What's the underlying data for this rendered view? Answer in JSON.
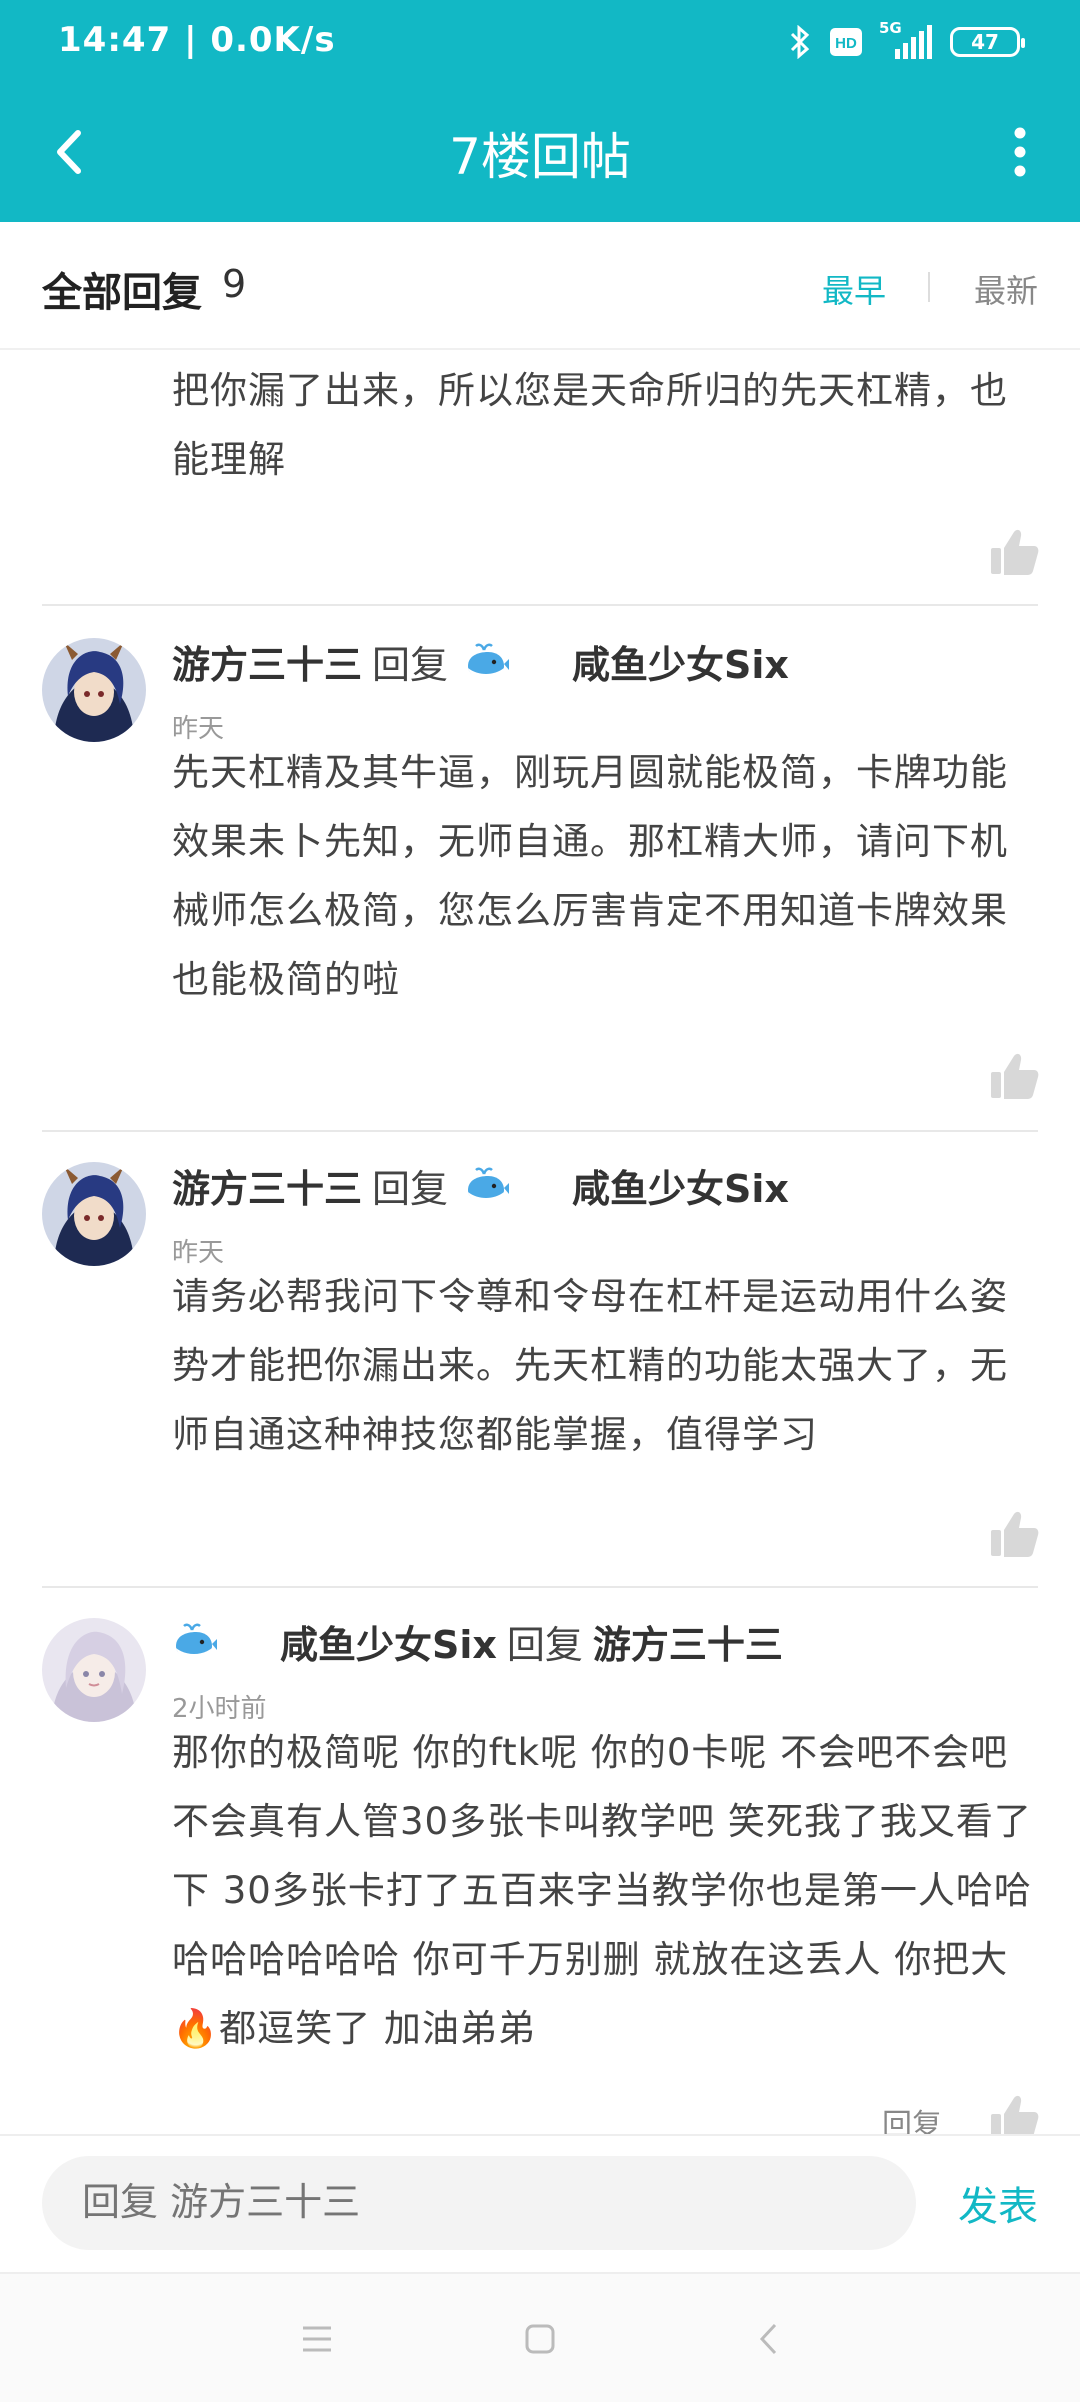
{
  "status_bar": {
    "time": "14:47 | 0.0K/s",
    "network": "5G",
    "battery": "47",
    "icons": [
      "bluetooth-icon",
      "hd-icon",
      "signal-icon",
      "battery-icon"
    ]
  },
  "app_bar": {
    "title": "7楼回帖",
    "back_icon": "back-arrow-icon",
    "more_icon": "more-vertical-icon"
  },
  "sort_bar": {
    "label": "全部回复",
    "count": "9",
    "earliest": "最早",
    "newest": "最新",
    "active": "最早"
  },
  "comments": [
    {
      "body": "把你漏了出来，所以您是天命所归的先天杠精，也能理解"
    },
    {
      "author": "游方三十三",
      "reply_word": "回复",
      "target": "咸鱼少女Six",
      "time": "昨天",
      "body": "先天杠精及其牛逼，刚玩月圆就能极简，卡牌功能效果未卜先知，无师自通。那杠精大师，请问下机械师怎么极简，您怎么厉害肯定不用知道卡牌效果也能极简的啦"
    },
    {
      "author": "游方三十三",
      "reply_word": "回复",
      "target": "咸鱼少女Six",
      "time": "昨天",
      "body": "请务必帮我问下令尊和令母在杠杆是运动用什么姿势才能把你漏出来。先天杠精的功能太强大了，无师自通这种神技您都能掌握，值得学习"
    },
    {
      "author": "咸鱼少女Six",
      "reply_word": "回复",
      "target": "游方三十三",
      "time": "2小时前",
      "body_before": "那你的极简呢 你的ftk呢 你的0卡呢 不会吧不会吧不会真有人管30多张卡叫教学吧 笑死我了我又看了下 30多张卡打了五百来字当教学你也是第一人哈哈哈哈哈哈哈哈 你可千万别删 就放在这丢人 你把大",
      "body_after": "都逗笑了 加油弟弟",
      "emoji": "🔥",
      "reply_label": "回复"
    }
  ],
  "input_bar": {
    "placeholder": "回复 游方三十三",
    "send": "发表"
  },
  "nav_bar": {
    "icons": [
      "menu-icon",
      "home-square-icon",
      "back-triangle-icon"
    ]
  },
  "colors": {
    "accent": "#12b8c5",
    "text": "#444444",
    "muted": "#999999"
  }
}
